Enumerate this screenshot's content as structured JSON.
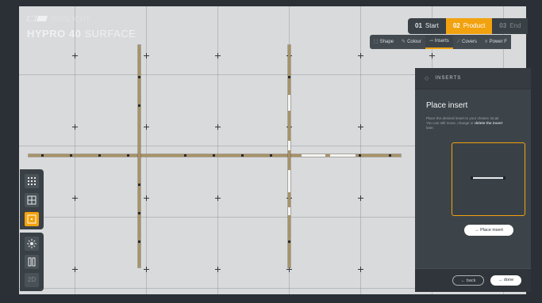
{
  "brand": {
    "sub": "PROLICHT",
    "title_bold": "HYPRO 40",
    "title_light": "SURFACE",
    "logo_icon": "prolicht-logo-icon"
  },
  "steps": [
    {
      "num": "01",
      "label": "Start",
      "state": "done"
    },
    {
      "num": "02",
      "label": "Product",
      "state": "active"
    },
    {
      "num": "03",
      "label": "End",
      "state": "upcoming"
    }
  ],
  "subtabs": [
    {
      "label": "Shape",
      "icon": "shape-icon",
      "glyph": "⬚"
    },
    {
      "label": "Colour",
      "icon": "colour-icon",
      "glyph": "✎"
    },
    {
      "label": "Inserts",
      "icon": "inserts-icon",
      "glyph": "⊸",
      "active": true
    },
    {
      "label": "Covers",
      "icon": "covers-icon",
      "glyph": "⟋"
    },
    {
      "label": "Power F",
      "icon": "power-icon",
      "glyph": "⌽"
    }
  ],
  "panel": {
    "header": "INSERTS",
    "header_icon": "inserts-icon",
    "title": "Place insert",
    "desc_1": "Place the desired insert to your chosen locati",
    "desc_2": "You can still move, change or ",
    "desc_bold": "delete the insert",
    "desc_3": "later.",
    "place_label": "→ Place insert",
    "back_label": "← back",
    "done_label": "→ done"
  },
  "tools": {
    "twod_label": "2D"
  },
  "colors": {
    "accent": "#f2a20f",
    "panel": "#3d4449",
    "profile": "#a89266",
    "canvas": "#d8dadb"
  }
}
